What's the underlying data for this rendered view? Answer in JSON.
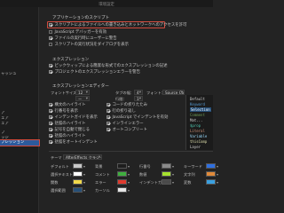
{
  "window": {
    "title": "環境設定"
  },
  "sidebar": {
    "items": [
      {
        "label": "",
        "state": "plain"
      },
      {
        "label": "ャッシュ",
        "state": "plain"
      },
      {
        "label": "ア",
        "state": "plain"
      },
      {
        "label": "ェア",
        "state": "plain"
      },
      {
        "label": "ェア",
        "state": "plain"
      },
      {
        "label": "ブ",
        "state": "plain"
      },
      {
        "label": "ッジ",
        "state": "plain"
      },
      {
        "label": "プレッション",
        "state": "selected"
      }
    ]
  },
  "app_scripts": {
    "title": "アプリケーションのスクリプト",
    "options": [
      {
        "label": "スクリプトによるファイルへの書き込みとネットワークへのアクセスを許可",
        "checked": true,
        "highlighted": true
      },
      {
        "label": "JavaScript デバッガーを有効",
        "checked": false,
        "highlighted": false
      },
      {
        "label": "ファイルの実行時にユーザーに警告",
        "checked": true,
        "highlighted": false
      },
      {
        "label": "スクリプトの実行状況をダイアログを表示",
        "checked": false,
        "highlighted": false
      }
    ]
  },
  "expressions": {
    "title": "エクスプレッション",
    "options": [
      {
        "label": "ピックウィップによる簡潔な形式でのエクスプレッションの記述",
        "checked": true
      },
      {
        "label": "プロジェクトのエクスプレッションエラーを警告",
        "checked": true
      }
    ]
  },
  "editor": {
    "title": "エクスプレッションエディター",
    "font_size_label": "フォントサイズ",
    "font_size_value": "12",
    "tab_width_label": "タブの幅：",
    "tab_width_value": "4",
    "font_label": "フォント：",
    "font_value": "Source Code Pro",
    "line_spacing_label": "行間：",
    "line_spacing_value": "1",
    "dash_value": "ー",
    "options": [
      {
        "label": "構文のハイライト",
        "checked": true
      },
      {
        "label": "行番号を表示",
        "checked": true
      },
      {
        "label": "インデントガイドを表示",
        "checked": true
      },
      {
        "label": "括弧のハイライト",
        "checked": true
      },
      {
        "label": "記号を自動で閉じる",
        "checked": true
      },
      {
        "label": "括弧のハイライト",
        "checked": true
      },
      {
        "label": "括弧をオートインデント",
        "checked": true
      }
    ],
    "options_right": [
      {
        "label": "コードの折りたたみ",
        "checked": true
      },
      {
        "label": "行の折り返し",
        "checked": true
      },
      {
        "label": "JavaScript でインデントを有効",
        "checked": true
      },
      {
        "label": "インラインエラー",
        "checked": true
      },
      {
        "label": "オートコンプリート",
        "checked": true
      }
    ]
  },
  "preview": {
    "lines": [
      {
        "text": "Default",
        "color": "#cfcfcf"
      },
      {
        "text": "Keyword",
        "color": "#569cd6"
      },
      {
        "text": "Selection",
        "color": "#ffffff"
      },
      {
        "text": "Comment",
        "color": "#6a9955"
      },
      {
        "text": "Mat...",
        "color": "#cfcfcf"
      },
      {
        "text": "$prop",
        "color": "#4ec9b0"
      },
      {
        "text": "Literal",
        "color": "#ce9178"
      },
      {
        "text": "Variable",
        "color": "#9cdcfe"
      },
      {
        "text": "thisComp",
        "color": "#dcdcaa"
      },
      {
        "text": "Layer",
        "color": "#cfcfcf"
      }
    ]
  },
  "theme": {
    "label": "テーマ",
    "value": "AfterEffects クラシック(デ",
    "colors": [
      {
        "label": "デフォルト",
        "color": "#c8c8c8"
      },
      {
        "label": "背景",
        "color": "#1e1e1e"
      },
      {
        "label": "行番号",
        "color": "#8a8a8a"
      },
      {
        "label": "キーワード",
        "color": "#2f6fe0"
      },
      {
        "label": "選択テキスト",
        "color": "#ffffff"
      },
      {
        "label": "コメント",
        "color": "#3fae3f"
      },
      {
        "label": "数値",
        "color": "#a6e22e"
      },
      {
        "label": "文字列",
        "color": "#e08a3a"
      },
      {
        "label": "関数",
        "color": "#f0d84a"
      },
      {
        "label": "エラー",
        "color": "#e03a2e"
      },
      {
        "label": "インデントガイド",
        "color": "#4a4a4a"
      },
      {
        "label": "変数",
        "color": "#3aa0e0"
      },
      {
        "label": "選択範囲",
        "color": "#264f78"
      },
      {
        "label": "カーソル",
        "color": "#e6e6e6"
      }
    ]
  }
}
